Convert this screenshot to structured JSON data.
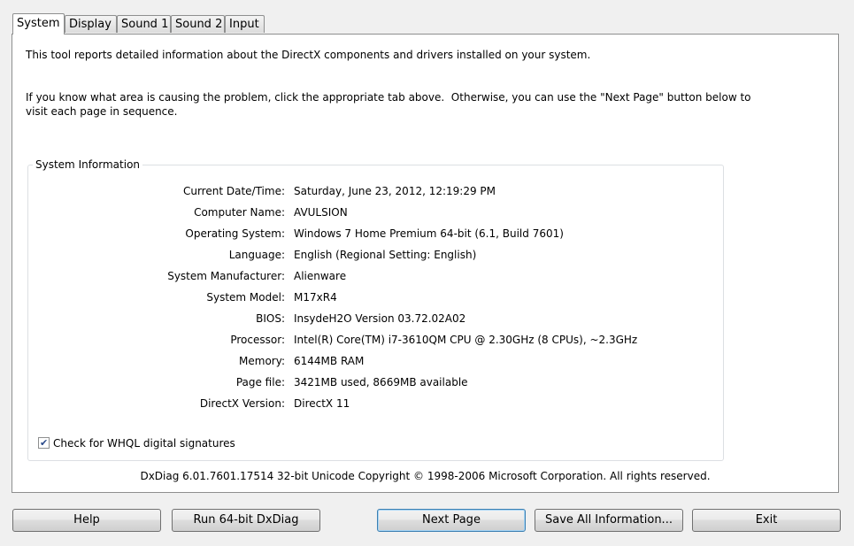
{
  "tabs": [
    {
      "label": "System",
      "active": true
    },
    {
      "label": "Display",
      "active": false
    },
    {
      "label": "Sound 1",
      "active": false
    },
    {
      "label": "Sound 2",
      "active": false
    },
    {
      "label": "Input",
      "active": false
    }
  ],
  "intro": {
    "line1": "This tool reports detailed information about the DirectX components and drivers installed on your system.",
    "line2": "If you know what area is causing the problem, click the appropriate tab above.  Otherwise, you can use the \"Next Page\" button below to\nvisit each page in sequence."
  },
  "system_info": {
    "title": "System Information",
    "rows": [
      {
        "label": "Current Date/Time:",
        "value": "Saturday, June 23, 2012, 12:19:29 PM"
      },
      {
        "label": "Computer Name:",
        "value": "AVULSION"
      },
      {
        "label": "Operating System:",
        "value": "Windows 7 Home Premium 64-bit (6.1, Build 7601)"
      },
      {
        "label": "Language:",
        "value": "English (Regional Setting: English)"
      },
      {
        "label": "System Manufacturer:",
        "value": "Alienware"
      },
      {
        "label": "System Model:",
        "value": "M17xR4"
      },
      {
        "label": "BIOS:",
        "value": "InsydeH2O Version 03.72.02A02"
      },
      {
        "label": "Processor:",
        "value": "Intel(R) Core(TM) i7-3610QM CPU @ 2.30GHz (8 CPUs), ~2.3GHz"
      },
      {
        "label": "Memory:",
        "value": "6144MB RAM"
      },
      {
        "label": "Page file:",
        "value": "3421MB used, 8669MB available"
      },
      {
        "label": "DirectX Version:",
        "value": "DirectX 11"
      }
    ]
  },
  "whql": {
    "label": "Check for WHQL digital signatures",
    "checked": true,
    "mark": "✔"
  },
  "footer": "DxDiag 6.01.7601.17514 32-bit Unicode  Copyright © 1998-2006 Microsoft Corporation.  All rights reserved.",
  "buttons": {
    "help": "Help",
    "run64": "Run 64-bit DxDiag",
    "next": "Next Page",
    "save": "Save All Information...",
    "exit": "Exit"
  }
}
